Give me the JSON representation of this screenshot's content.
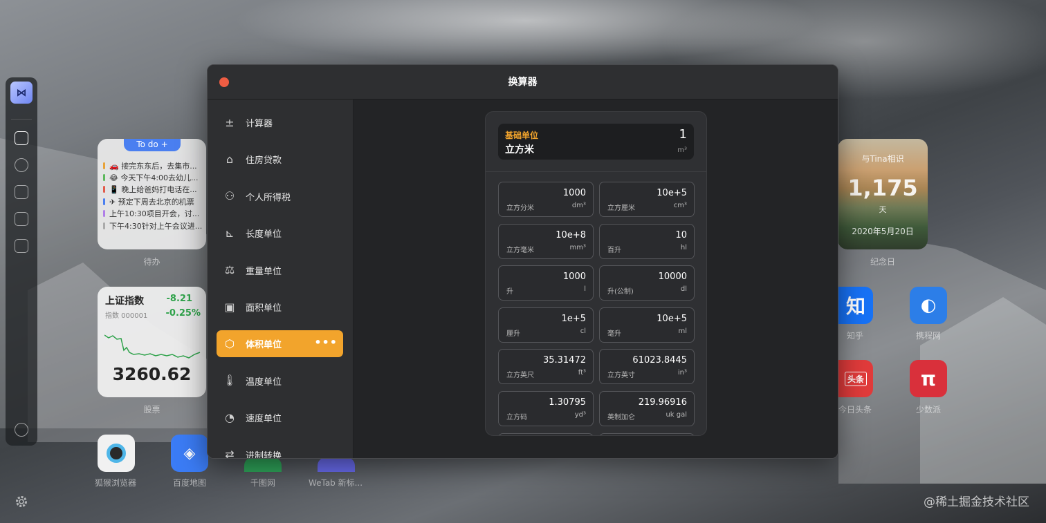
{
  "modal": {
    "title": "换算器"
  },
  "sidebar": {
    "items": [
      {
        "label": "计算器",
        "icon": "calculator-icon"
      },
      {
        "label": "住房贷款",
        "icon": "house-loan-icon"
      },
      {
        "label": "个人所得税",
        "icon": "person-tax-icon"
      },
      {
        "label": "长度单位",
        "icon": "ruler-icon"
      },
      {
        "label": "重量单位",
        "icon": "weight-icon"
      },
      {
        "label": "面积单位",
        "icon": "area-icon"
      },
      {
        "label": "体积单位",
        "icon": "cube-icon",
        "active": true,
        "more": "•••"
      },
      {
        "label": "温度单位",
        "icon": "thermometer-icon"
      },
      {
        "label": "速度单位",
        "icon": "speedometer-icon"
      },
      {
        "label": "进制转换",
        "icon": "base-convert-icon"
      }
    ]
  },
  "converter": {
    "base": {
      "caption": "基础单位",
      "name": "立方米",
      "value": "1",
      "unit": "m³"
    },
    "cells": [
      {
        "value": "1000",
        "name": "立方分米",
        "unit": "dm³"
      },
      {
        "value": "10e+5",
        "name": "立方厘米",
        "unit": "cm³"
      },
      {
        "value": "10e+8",
        "name": "立方毫米",
        "unit": "mm³"
      },
      {
        "value": "10",
        "name": "百升",
        "unit": "hl"
      },
      {
        "value": "1000",
        "name": "升",
        "unit": "l"
      },
      {
        "value": "10000",
        "name": "升(公制)",
        "unit": "dl"
      },
      {
        "value": "1e+5",
        "name": "厘升",
        "unit": "cl"
      },
      {
        "value": "10e+5",
        "name": "毫升",
        "unit": "ml"
      },
      {
        "value": "35.31472",
        "name": "立方英尺",
        "unit": "ft³"
      },
      {
        "value": "61023.8445",
        "name": "立方英寸",
        "unit": "in³"
      },
      {
        "value": "1.30795",
        "name": "立方码",
        "unit": "yd³"
      },
      {
        "value": "219.96916",
        "name": "英制加仑",
        "unit": "uk gal"
      }
    ]
  },
  "todo": {
    "tab": "To do +",
    "label": "待办",
    "items": [
      {
        "text": "🚗 接完东东后，去集市...",
        "color": "#e8a33a"
      },
      {
        "text": "😂 今天下午4:00去幼儿...",
        "color": "#5cb85c"
      },
      {
        "text": "📱 晚上给爸妈打电话在...",
        "color": "#e25b4b"
      },
      {
        "text": "✈ 预定下周去北京的机票",
        "color": "#4a7ff0"
      },
      {
        "text": "上午10:30项目开会，讨...",
        "color": "#b07ee8"
      },
      {
        "text": "下午4:30针对上午会议进...",
        "color": "#aaaaaa"
      }
    ]
  },
  "stock": {
    "name": "上证指数",
    "code": "指数 000001",
    "change": "-8.21",
    "percent": "-0.25%",
    "price": "3260.62",
    "label": "股票"
  },
  "anniversary": {
    "title": "与Tina相识",
    "days": "1,175",
    "unit": "天",
    "date": "2020年5月20日",
    "label": "纪念日"
  },
  "apps": [
    {
      "name": "狐猴浏览器",
      "color": "#4fb6e8"
    },
    {
      "name": "百度地图",
      "color": "#3b7cf5"
    },
    {
      "name": "千图网",
      "color": "#2fa55a"
    },
    {
      "name": "WeTab 新标...",
      "color": "#6a6cf0"
    },
    {
      "name": "知乎",
      "glyph": "知",
      "color": "#1772f6"
    },
    {
      "name": "携程网",
      "color": "#2c7ee8"
    },
    {
      "name": "今日头条",
      "glyph": "头条",
      "color": "#e13b3b"
    },
    {
      "name": "少数派",
      "glyph": "π",
      "color": "#d9303b"
    }
  ],
  "watermark": "@稀土掘金技术社区"
}
